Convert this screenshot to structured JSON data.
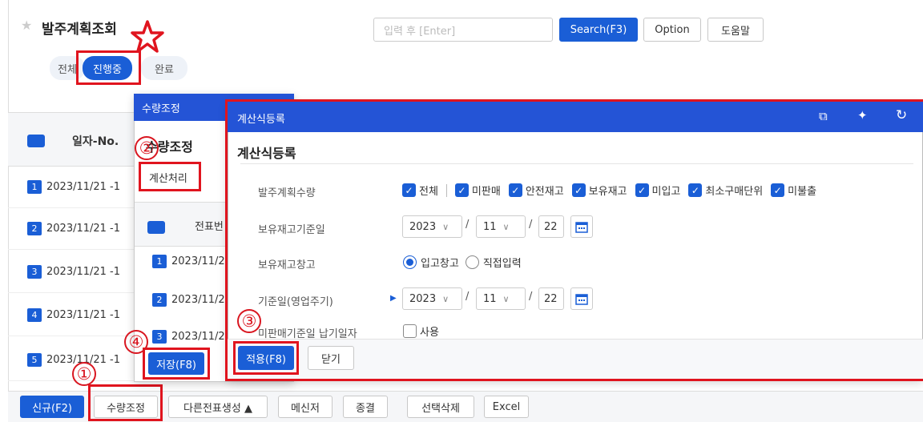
{
  "page": {
    "title": "발주계획조회",
    "search_placeholder": "입력 후 [Enter]",
    "search_button": "Search(F3)",
    "option_button": "Option",
    "help_button": "도움말",
    "filter_tabs": [
      "전체",
      "진행중",
      "완료"
    ]
  },
  "list": {
    "header_col": "일자-No.",
    "rows": [
      {
        "num": "1",
        "date": "2023/11/21 -1"
      },
      {
        "num": "2",
        "date": "2023/11/21 -1"
      },
      {
        "num": "3",
        "date": "2023/11/21 -1"
      },
      {
        "num": "4",
        "date": "2023/11/21 -1"
      },
      {
        "num": "5",
        "date": "2023/11/21 -1"
      }
    ]
  },
  "bottom_bar": {
    "buttons": [
      "신규(F2)",
      "수량조정",
      "다른전표생성 ▲",
      "메신저",
      "종결",
      "선택삭제",
      "Excel"
    ]
  },
  "modal_qty": {
    "bar_title": "수량조정",
    "heading": "수량조정",
    "tab": "계산처리",
    "header_col": "전표번",
    "rows": [
      {
        "num": "1",
        "date": "2023/11/2"
      },
      {
        "num": "2",
        "date": "2023/11/2"
      },
      {
        "num": "3",
        "date": "2023/11/2"
      }
    ],
    "save_button": "저장(F8)"
  },
  "modal_formula": {
    "bar_title": "계산식등록",
    "heading": "계산식등록",
    "fields": {
      "plan_qty_label": "발주계획수량",
      "plan_qty_options": [
        "전체",
        "미판매",
        "안전재고",
        "보유재고",
        "미입고",
        "최소구매단위",
        "미불출"
      ],
      "stock_date_label": "보유재고기준일",
      "stock_date": {
        "year": "2023",
        "month": "11",
        "day": "22"
      },
      "stock_wh_label": "보유재고창고",
      "stock_wh_options": [
        "입고창고",
        "직접입력"
      ],
      "base_date_label": "기준일(영업주기)",
      "base_date": {
        "year": "2023",
        "month": "11",
        "day": "22"
      },
      "unsold_label": "미판매기준일 납기일자",
      "unsold_option": "사용"
    },
    "apply_button": "적용(F8)",
    "close_button": "닫기"
  },
  "annotations": {
    "step1": "①",
    "step2": "②",
    "step3": "③",
    "step4": "④"
  },
  "colors": {
    "primary": "#1a5ed6",
    "modal_bar": "#2454d6",
    "annotation_red": "#e0141e"
  }
}
